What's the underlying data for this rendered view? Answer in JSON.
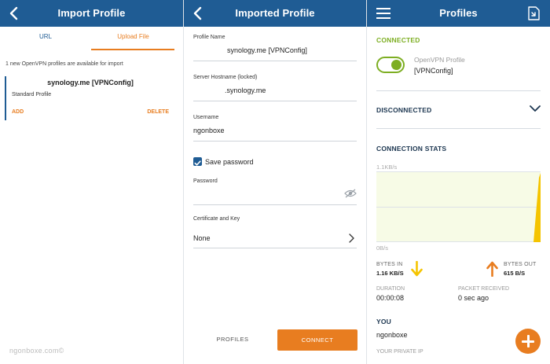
{
  "import_profile": {
    "title": "Import Profile",
    "tabs": {
      "url": "URL",
      "upload_file": "Upload File"
    },
    "notice": "1 new OpenVPN profiles are available for import",
    "profile": {
      "name": "synology.me [VPNConfig]",
      "type": "Standard Profile",
      "add_label": "ADD",
      "delete_label": "DELETE"
    }
  },
  "imported_profile": {
    "title": "Imported Profile",
    "profile_name": {
      "label": "Profile Name",
      "value": "synology.me [VPNConfig]"
    },
    "server_hostname": {
      "label": "Server Hostname (locked)",
      "value": ".synology.me"
    },
    "username": {
      "label": "Username",
      "value": "ngonboxe"
    },
    "save_password": {
      "label": "Save password",
      "checked": true
    },
    "password": {
      "label": "Password",
      "value": ""
    },
    "certificate": {
      "label": "Certificate and Key",
      "value": "None"
    },
    "buttons": {
      "profiles": "PROFILES",
      "connect": "CONNECT"
    }
  },
  "profiles": {
    "title": "Profiles",
    "connected_heading": "CONNECTED",
    "connected_profile": {
      "name": "OpenVPN Profile",
      "config": "[VPNConfig]",
      "toggle_on": true
    },
    "disconnected_heading": "DISCONNECTED",
    "stats_heading": "CONNECTION STATS",
    "graph": {
      "top_label": "1.1KB/s",
      "bottom_label": "0B/s"
    },
    "bytes_in": {
      "label": "BYTES IN",
      "value": "1.16 KB/S"
    },
    "bytes_out": {
      "label": "BYTES OUT",
      "value": "615 B/S"
    },
    "duration": {
      "label": "DURATION",
      "value": "00:00:08"
    },
    "packet_received": {
      "label": "PACKET RECEIVED",
      "value": "0 sec ago"
    },
    "you_heading": "YOU",
    "you_name": "ngonboxe",
    "private_ip_label": "YOUR PRIVATE IP"
  },
  "watermark": "ngonboxe.com©",
  "colors": {
    "header": "#1f5c94",
    "accent_orange": "#e87d20",
    "connected_green": "#7dae22",
    "arrow_yellow": "#f5c400"
  },
  "icons": {
    "back": "chevron-left-icon",
    "menu": "hamburger-menu-icon",
    "import": "import-file-icon",
    "checkbox": "checkmark-icon",
    "password_visibility": "eye-off-icon",
    "certificate_more": "chevron-right-icon",
    "disconnected_expand": "chevron-down-icon",
    "bytes_in": "arrow-down-icon",
    "bytes_out": "arrow-up-icon",
    "add_profile": "plus-icon"
  }
}
